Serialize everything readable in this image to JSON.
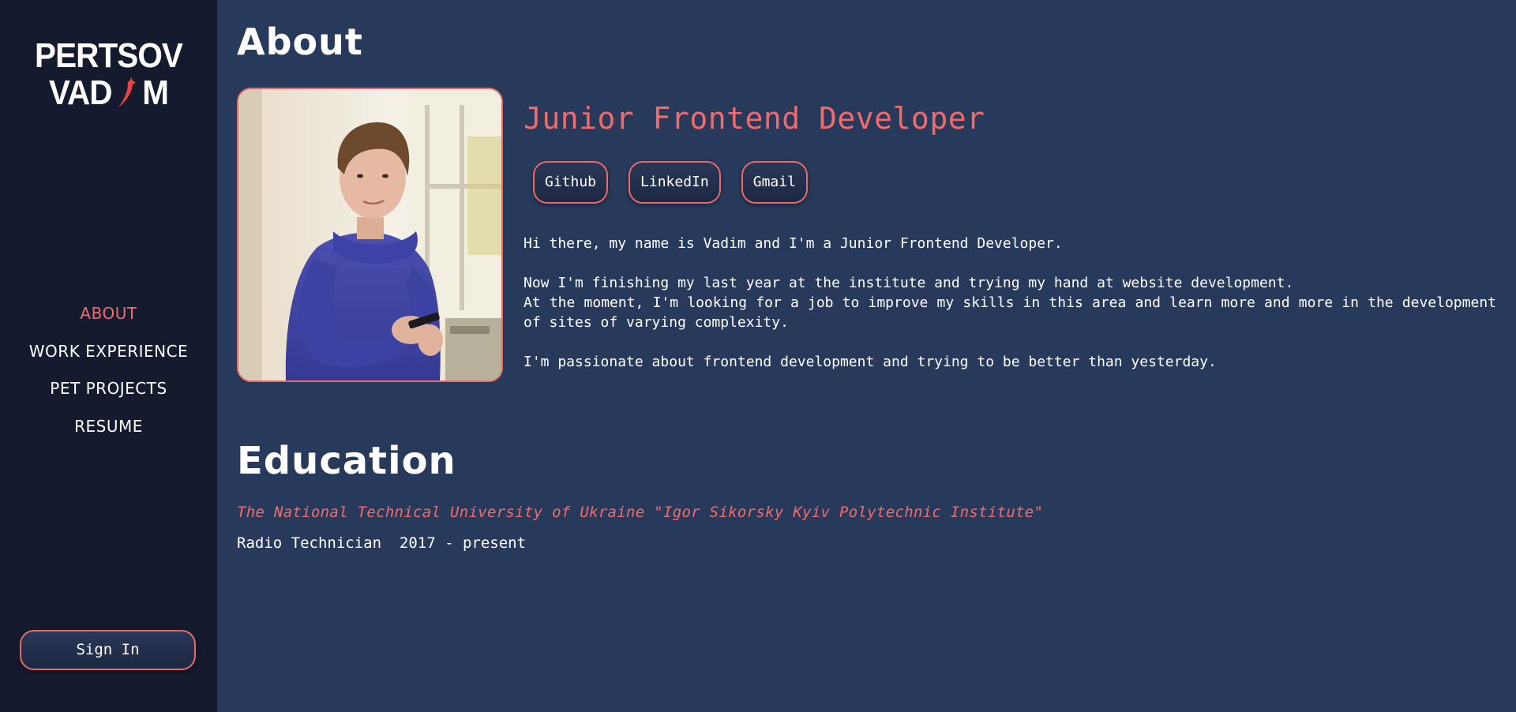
{
  "sidebar": {
    "logo": {
      "line1": "PERTSOV",
      "line2_start": "VAD",
      "line2_end": "M"
    },
    "nav": [
      {
        "label": "ABOUT",
        "active": true
      },
      {
        "label": "WORK EXPERIENCE",
        "active": false
      },
      {
        "label": "PET PROJECTS",
        "active": false
      },
      {
        "label": "RESUME",
        "active": false
      }
    ],
    "sign_in_label": "Sign In"
  },
  "about": {
    "heading": "About",
    "role": "Junior Frontend Developer",
    "links": [
      {
        "label": "Github"
      },
      {
        "label": "LinkedIn"
      },
      {
        "label": "Gmail"
      }
    ],
    "bio": [
      "Hi there, my name is Vadim and I'm a Junior Frontend Developer.",
      "Now I'm finishing my last year at the institute and trying my hand at website development.",
      "At the moment, I'm looking for a job to improve my skills in this area and learn more and more in the development of sites of varying complexity.",
      "I'm passionate about frontend development and trying to be better than yesterday."
    ]
  },
  "education": {
    "heading": "Education",
    "institution": "The National Technical University of Ukraine \"Igor Sikorsky Kyiv Polytechnic Institute\"",
    "degree": "Radio Technician  2017 - present"
  },
  "colors": {
    "accent": "#f26b6b",
    "sidebar_bg": "#151b2e",
    "main_bg": "#283a5b",
    "text": "#ffffff"
  },
  "icons": {
    "logo_letter_i": "chili-pepper-icon"
  }
}
